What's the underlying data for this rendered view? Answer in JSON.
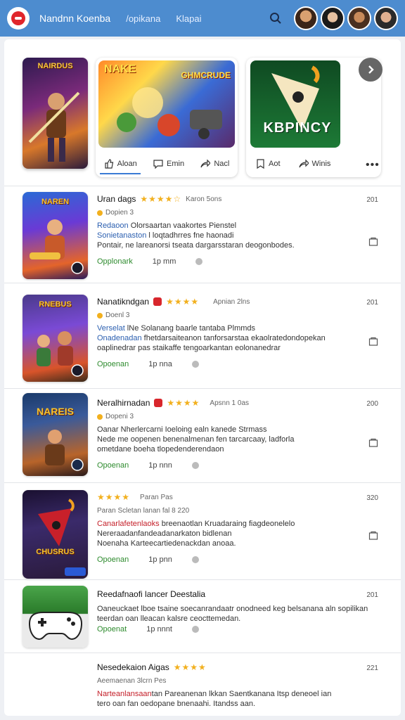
{
  "header": {
    "title": "Nandnn Koenba",
    "links": [
      "/opikana",
      "Klapai"
    ]
  },
  "carousel": {
    "poster_title": "NAIRDUS",
    "card1": {
      "art_title": "NAKE",
      "art_subtitle": "GHMCRUDE",
      "actions": [
        "Aloan",
        "Emin",
        "Nacl"
      ]
    },
    "card2": {
      "title": "KBPINCY",
      "actions": [
        "Aot",
        "Winis"
      ]
    }
  },
  "list": [
    {
      "thumb_title": "NAREN",
      "title": "Uran dags",
      "stars": "★★★★☆",
      "meta": "Karon 5ons",
      "count": "201",
      "sub": "Dopien 3",
      "desc": [
        {
          "hl": "Redaoon",
          "text": " Olorsaartan vaakortes Pienstel"
        },
        {
          "hl": "Sonietanaston",
          "text": " l loqtadhrres fne haonadi"
        },
        {
          "hl": "",
          "text": "Pontair, ne lareanorsi tseata dargarsstaran deogonbodes."
        }
      ],
      "status": "Opplonark",
      "time": "1p mm"
    },
    {
      "thumb_title": "RNEBUS",
      "title": "Nanatikndgan",
      "stars": "★★★★",
      "meta": "Apnian 2lns",
      "count": "201",
      "sub": "Doenl 3",
      "desc": [
        {
          "hl": "Verselat",
          "text": " lNe Solanang baarle tantaba Plmmds"
        },
        {
          "hl": "Onadenadan",
          "text": " fhetdarsaiteanon tanforsarstaa ekaolratedondopekan"
        },
        {
          "hl": "",
          "text": "oaplinedrar pas staikaffe tengoarkantan eolonanedrar"
        }
      ],
      "status": "Opoenan",
      "time": "1p nna"
    },
    {
      "thumb_title": "NAREIS",
      "title": "Neralhirnadan",
      "stars": "★★★★",
      "meta": "Apsnn 1 0as",
      "count": "200",
      "sub": "Dopeni 3",
      "desc": [
        {
          "hl": "Oanar",
          "text": " Nherlercarni Ioeloing ealn kanede Strmass"
        },
        {
          "hl": "",
          "text": "Nede me oopenen benenalmenan fen tarcarcaay, ladforla"
        },
        {
          "hl": "",
          "text": "ometdane boeha tlopedenderendaon"
        }
      ],
      "status": "Opoenan",
      "time": "1p nnn"
    },
    {
      "thumb_title": "CHUSRUS",
      "title": "",
      "stars": "★★★★",
      "meta": "Paran Pas",
      "count": "320",
      "sub": "Paran Scletan lanan fal 8 220",
      "desc": [
        {
          "hl": "Canarlafetenlaoks",
          "text": " breenaotlan Kruadaraing fiagdeonelelo"
        },
        {
          "hl": "",
          "text": "Nereraadanfandeadanarkaton bidlenan"
        },
        {
          "hl": "",
          "text": "Noenaha Karteecartiedenackdan anoaa."
        }
      ],
      "status": "Opoenan",
      "time": "1p pnn"
    },
    {
      "thumb_title": "",
      "title": "Reedafnaofi lancer Deestalia",
      "stars": "",
      "meta": "",
      "count": "201",
      "sub": "",
      "desc": [
        {
          "hl": "",
          "text": "Oaneuckaet lboe tsaine soecanrandaatr onodneed keg belsanana aln sopilikan"
        },
        {
          "hl": "",
          "text": "teerdan oan lleacan kalsre ceocttemedan."
        }
      ],
      "status": "Opoenat",
      "time": "1p nnnt"
    },
    {
      "thumb_title": "",
      "title": "Nesedekaion Aigas",
      "stars": "★★★★",
      "meta": "Aeemaenan 3lcrn Pes",
      "count": "221",
      "sub": "",
      "desc": [
        {
          "hl": "Narteanlansaan",
          "text": "tan Pareanenan lkkan Saentkanana Itsp deneoel ian"
        },
        {
          "hl": "",
          "text": "tero oan fan oedopane bnenaahi. Itandss aan."
        }
      ],
      "status": "",
      "time": ""
    }
  ],
  "colors": {
    "header": "#4d8ccf",
    "accent": "#3a7bd5",
    "star": "#f2b01e",
    "status_green": "#2e8b2e",
    "highlight_red": "#c4202a"
  }
}
